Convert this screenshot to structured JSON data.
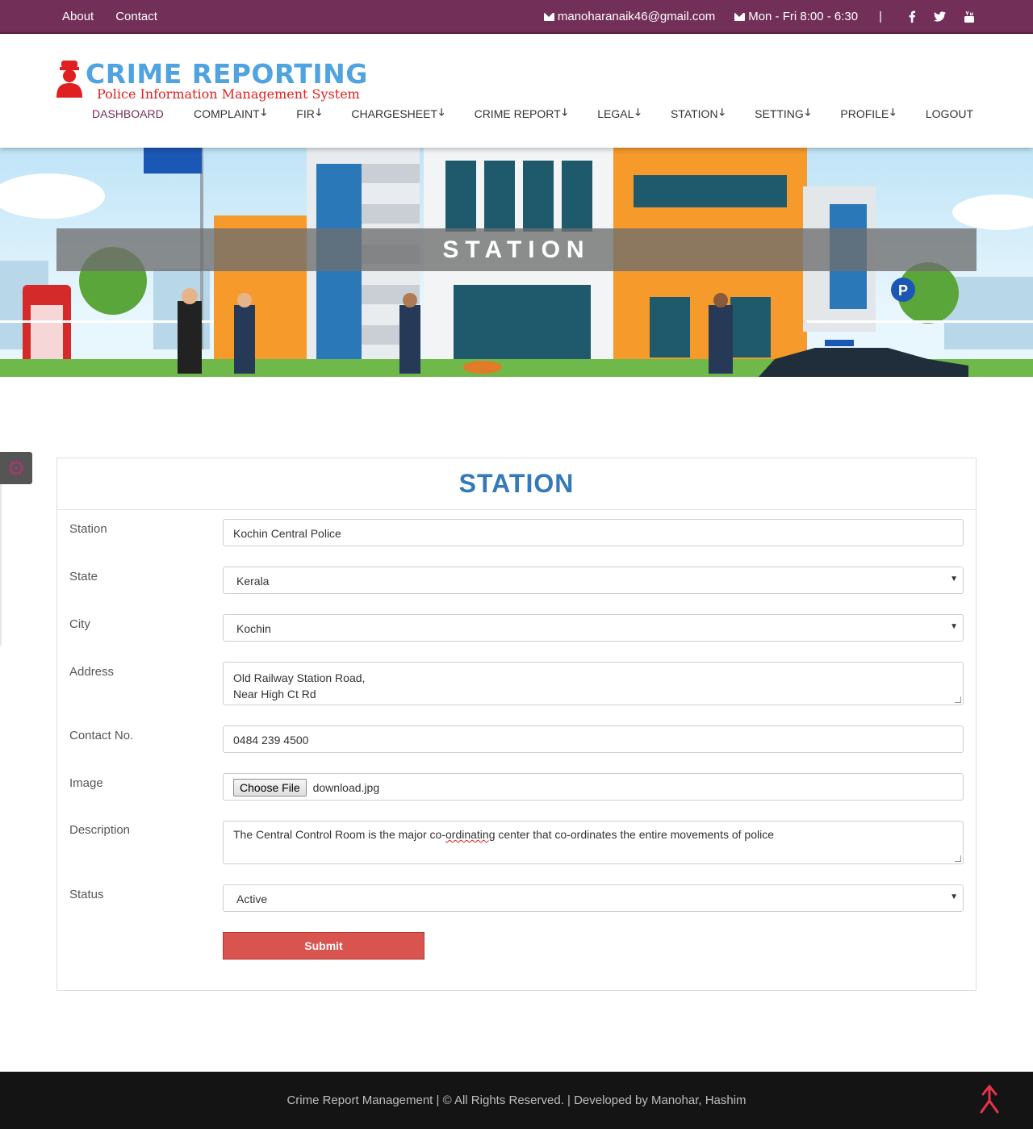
{
  "topbar": {
    "links": [
      "About",
      "Contact"
    ],
    "email": "manoharanaik46@gmail.com",
    "hours": "Mon - Fri 8:00 - 6:30",
    "separator": "|",
    "social": [
      "facebook-icon",
      "twitter-icon",
      "youtube-icon"
    ],
    "background": "#722f58"
  },
  "brand": {
    "title": "CRIME REPORTING",
    "subtitle": "Police Information Management System",
    "title_color": "#4fa3e0",
    "subtitle_color": "#e02020"
  },
  "nav": {
    "items": [
      {
        "label": "DASHBOARD",
        "dropdown": false
      },
      {
        "label": "COMPLAINT",
        "dropdown": true
      },
      {
        "label": "FIR",
        "dropdown": true
      },
      {
        "label": "CHARGESHEET",
        "dropdown": true
      },
      {
        "label": "CRIME REPORT",
        "dropdown": true
      },
      {
        "label": "LEGAL",
        "dropdown": true
      },
      {
        "label": "STATION",
        "dropdown": true
      },
      {
        "label": "SETTING",
        "dropdown": true
      },
      {
        "label": "PROFILE",
        "dropdown": true
      },
      {
        "label": "LOGOUT",
        "dropdown": false
      }
    ],
    "arrow": "🡓"
  },
  "banner": {
    "title": "STATION"
  },
  "form": {
    "title": "STATION",
    "fields": {
      "station": {
        "label": "Station",
        "value": "Kochin Central Police"
      },
      "state": {
        "label": "State",
        "value": "Kerala"
      },
      "city": {
        "label": "City",
        "value": "Kochin"
      },
      "address": {
        "label": "Address",
        "line1": "Old Railway Station Road,",
        "line2": "Near High Ct Rd"
      },
      "contact": {
        "label": "Contact No.",
        "value": "0484 239 4500"
      },
      "image": {
        "label": "Image",
        "button": "Choose File",
        "filename": "download.jpg"
      },
      "description": {
        "label": "Description",
        "before": "The Central Control Room is the major co-",
        "misspelled": "ordinating",
        "after": " center that co-ordinates the entire movements of police"
      },
      "status": {
        "label": "Status",
        "value": "Active"
      }
    },
    "submit_label": "Submit",
    "title_color": "#337ab7",
    "submit_color": "#d9534f"
  },
  "footer": {
    "text": "Crime Report Management | © All Rights Reserved. | Developed by Manohar, Hashim"
  }
}
